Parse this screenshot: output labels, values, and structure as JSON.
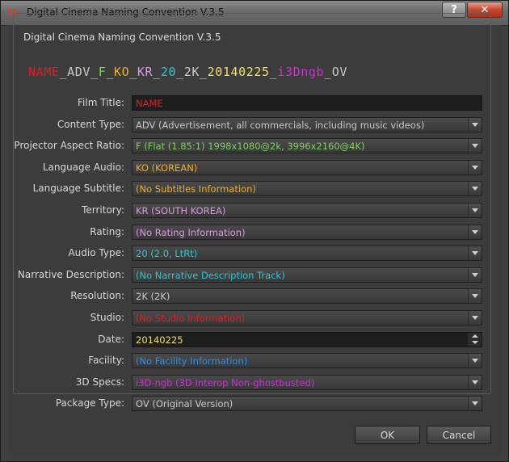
{
  "window": {
    "title": "Digital Cinema Naming Convention V.3.5",
    "help_label": "?",
    "close_label": "✕"
  },
  "group": {
    "title": "Digital Cinema Naming Convention V.3.5"
  },
  "preview": {
    "segments": [
      {
        "text": "NAME",
        "color": "#e02020"
      },
      {
        "text": "_",
        "color": "#c8c8c8"
      },
      {
        "text": "ADV",
        "color": "#c8c8c8"
      },
      {
        "text": "_",
        "color": "#c8c8c8"
      },
      {
        "text": "F",
        "color": "#7ed35a"
      },
      {
        "text": "_",
        "color": "#c8c8c8"
      },
      {
        "text": "KO",
        "color": "#f0b020"
      },
      {
        "text": "_",
        "color": "#c8c8c8"
      },
      {
        "text": "KR",
        "color": "#d99be0"
      },
      {
        "text": "_",
        "color": "#c8c8c8"
      },
      {
        "text": "20",
        "color": "#30c8d0"
      },
      {
        "text": "_",
        "color": "#c8c8c8"
      },
      {
        "text": "2K",
        "color": "#c8c8c8"
      },
      {
        "text": "_",
        "color": "#c8c8c8"
      },
      {
        "text": "20140225",
        "color": "#f0e060"
      },
      {
        "text": "_",
        "color": "#c8c8c8"
      },
      {
        "text": "i3Dngb",
        "color": "#d030d8"
      },
      {
        "text": "_",
        "color": "#c8c8c8"
      },
      {
        "text": "OV",
        "color": "#c8c8c8"
      }
    ]
  },
  "fields": [
    {
      "label": "Film Title:",
      "value": "NAME",
      "kind": "text",
      "color": "#e02020"
    },
    {
      "label": "Content Type:",
      "value": "ADV (Advertisement, all commercials, including music videos)",
      "kind": "combo",
      "color": "#c8c8c8"
    },
    {
      "label": "Projector Aspect Ratio:",
      "value": "F (Flat (1.85:1) 1998x1080@2k, 3996x2160@4K)",
      "kind": "combo",
      "color": "#7ed35a"
    },
    {
      "label": "Language Audio:",
      "value": "KO (KOREAN)",
      "kind": "combo",
      "color": "#f0b020"
    },
    {
      "label": "Language Subtitle:",
      "value": " (No Subtitles Information)",
      "kind": "combo",
      "color": "#f0b020"
    },
    {
      "label": "Territory:",
      "value": "KR (SOUTH KOREA)",
      "kind": "combo",
      "color": "#d99be0"
    },
    {
      "label": "Rating:",
      "value": " (No Rating Information)",
      "kind": "combo",
      "color": "#d99be0"
    },
    {
      "label": "Audio Type:",
      "value": "20 (2.0, LtRt)",
      "kind": "combo",
      "color": "#30c8d0"
    },
    {
      "label": "Narrative Description:",
      "value": " (No Narrative Description Track)",
      "kind": "combo",
      "color": "#30c8d0"
    },
    {
      "label": "Resolution:",
      "value": "2K (2K)",
      "kind": "combo",
      "color": "#c8c8c8"
    },
    {
      "label": "Studio:",
      "value": " (No Studio Information)",
      "kind": "combo",
      "color": "#e02020"
    },
    {
      "label": "Date:",
      "value": "20140225",
      "kind": "date",
      "color": "#f0e060"
    },
    {
      "label": "Facility:",
      "value": " (No Facility Information)",
      "kind": "combo",
      "color": "#3090e8"
    },
    {
      "label": "3D Specs:",
      "value": "i3D-ngb (3D Interop Non-ghostbusted)",
      "kind": "combo",
      "color": "#d030d8"
    },
    {
      "label": "Package Type:",
      "value": "OV (Original Version)",
      "kind": "combo",
      "color": "#c8c8c8"
    }
  ],
  "buttons": {
    "ok": "OK",
    "cancel": "Cancel"
  }
}
